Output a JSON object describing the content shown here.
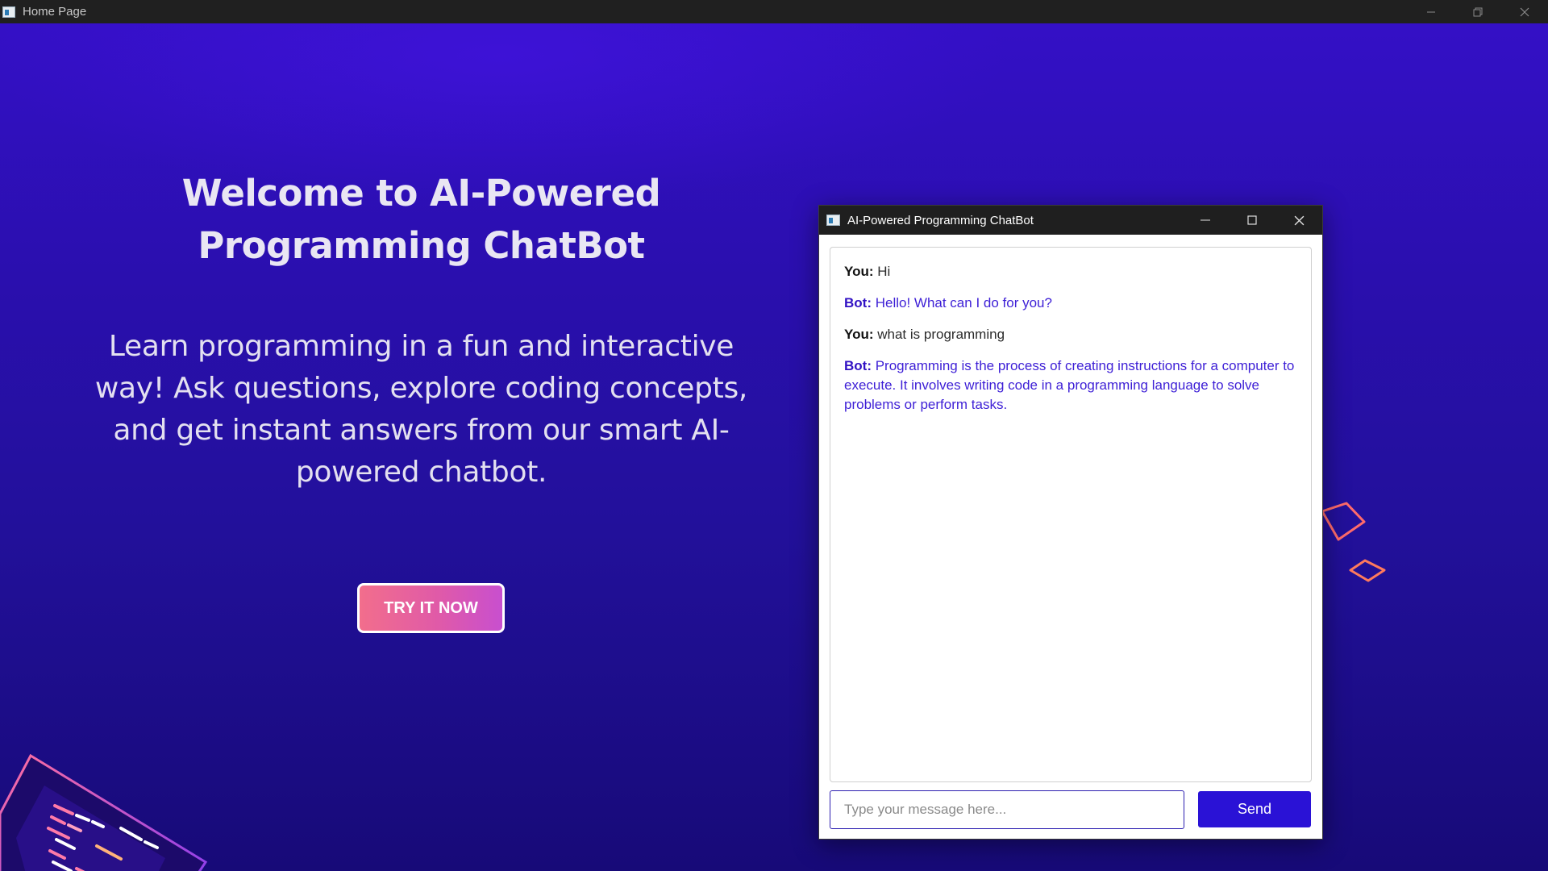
{
  "window": {
    "title": "Home Page"
  },
  "hero": {
    "title": "Welcome to AI-Powered Programming ChatBot",
    "subtitle": "Learn programming in a fun and interactive way! Ask questions, explore coding concepts, and get instant answers from our smart AI-powered chatbot.",
    "cta_label": "TRY IT NOW"
  },
  "chat": {
    "window_title": "AI-Powered Programming ChatBot",
    "messages": [
      {
        "sender": "You:",
        "text": "Hi"
      },
      {
        "sender": "Bot:",
        "text": "Hello! What can I do for you?"
      },
      {
        "sender": "You:",
        "text": "what is programming"
      },
      {
        "sender": "Bot:",
        "text": "Programming is the process of creating instructions for a computer to execute. It involves writing code in a programming language to solve problems or perform tasks."
      }
    ],
    "input_placeholder": "Type your message here...",
    "send_label": "Send"
  },
  "colors": {
    "accent": "#2a12d6",
    "bot_text": "#3d1fd6",
    "cta_gradient_start": "#f26e8c",
    "cta_gradient_end": "#c84fcf"
  },
  "icons": {
    "app": "app-window-icon",
    "minimize": "minimize-icon",
    "maximize": "maximize-icon",
    "restore": "restore-icon",
    "close": "close-icon"
  }
}
